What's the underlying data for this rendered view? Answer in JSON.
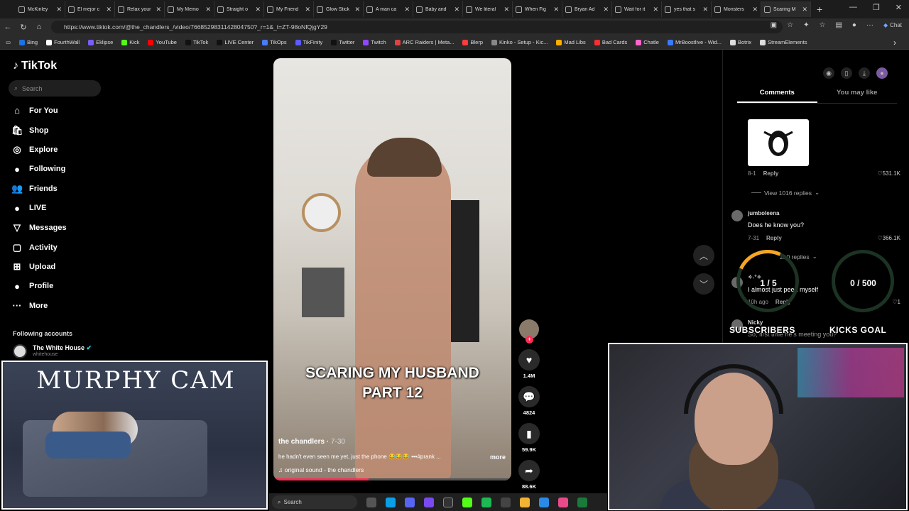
{
  "browser": {
    "tabs": [
      {
        "title": "McKinley"
      },
      {
        "title": "El mejor c"
      },
      {
        "title": "Relax your"
      },
      {
        "title": "My Memo"
      },
      {
        "title": "Straight o"
      },
      {
        "title": "My Friend"
      },
      {
        "title": "Glow Stick"
      },
      {
        "title": "A man ca"
      },
      {
        "title": "Baby and"
      },
      {
        "title": "We literal"
      },
      {
        "title": "When Fig"
      },
      {
        "title": "Bryan Ad"
      },
      {
        "title": "Wait for it"
      },
      {
        "title": "yes that s"
      },
      {
        "title": "Monsters"
      },
      {
        "title": "Scaring M",
        "active": true
      }
    ],
    "url": "https://www.tiktok.com/@the_chandlers_/video/7668529831142804750?_r=1&_t=ZT-98oNfQjgY29",
    "chat_label": "Chat",
    "bookmarks": [
      {
        "label": "Bing",
        "color": "#1a73e8"
      },
      {
        "label": "FourthWall",
        "color": "#ffffff"
      },
      {
        "label": "Eklipse",
        "color": "#7b5cff"
      },
      {
        "label": "Kick",
        "color": "#53fc18"
      },
      {
        "label": "YouTube",
        "color": "#ff0000"
      },
      {
        "label": "TikTok",
        "color": "#111111"
      },
      {
        "label": "LIVE Center",
        "color": "#111111"
      },
      {
        "label": "TikOps",
        "color": "#4a7bff"
      },
      {
        "label": "TikFinity",
        "color": "#5b5bff"
      },
      {
        "label": "Twitter",
        "color": "#111111"
      },
      {
        "label": "Twitch",
        "color": "#9146ff"
      },
      {
        "label": "ARC Raiders | Meta...",
        "color": "#d44"
      },
      {
        "label": "Blerp",
        "color": "#ff3b3b"
      },
      {
        "label": "Kinko - Setup - Kic...",
        "color": "#888888"
      },
      {
        "label": "Mad Libs",
        "color": "#ffae00"
      },
      {
        "label": "Bad Cards",
        "color": "#ff2d2d"
      },
      {
        "label": "Chatle",
        "color": "#ff66cc"
      },
      {
        "label": "MrBoostlive - Wid...",
        "color": "#3a7aff"
      },
      {
        "label": "Botrix",
        "color": "#dddddd"
      },
      {
        "label": "StreamElements",
        "color": "#dddddd"
      }
    ]
  },
  "sidebar": {
    "logo": "TikTok",
    "search_placeholder": "Search",
    "nav": [
      {
        "label": "For You",
        "icon": "home-icon",
        "glyph": "⌂"
      },
      {
        "label": "Shop",
        "icon": "shop-icon",
        "glyph": "🛍"
      },
      {
        "label": "Explore",
        "icon": "compass-icon",
        "glyph": "◎"
      },
      {
        "label": "Following",
        "icon": "following-avatar-icon",
        "glyph": "●"
      },
      {
        "label": "Friends",
        "icon": "friends-icon",
        "glyph": "👥"
      },
      {
        "label": "LIVE",
        "icon": "live-icon",
        "glyph": "●"
      },
      {
        "label": "Messages",
        "icon": "messages-icon",
        "glyph": "▽"
      },
      {
        "label": "Activity",
        "icon": "activity-icon",
        "glyph": "▢"
      },
      {
        "label": "Upload",
        "icon": "upload-icon",
        "glyph": "⊞"
      },
      {
        "label": "Profile",
        "icon": "profile-icon",
        "glyph": "●"
      },
      {
        "label": "More",
        "icon": "more-icon",
        "glyph": "···"
      }
    ],
    "following_title": "Following accounts",
    "following": [
      {
        "name": "The White House",
        "handle": "whitehouse"
      }
    ]
  },
  "video": {
    "caption_line1": "SCARING MY HUSBAND",
    "caption_line2": "PART 12",
    "author": "the chandlers",
    "date": "7-30",
    "description": "he hadn't even seen me yet, just the phone 😂😂😂 •••#prank ...",
    "more_label": "more",
    "sound": "original sound - the chandlers",
    "progress": 0.4
  },
  "actions": {
    "likes": "1.4M",
    "comments": "4824",
    "saves": "59.9K",
    "shares": "88.6K"
  },
  "comments_panel": {
    "tabs": [
      "Comments",
      "You may like"
    ],
    "comments": [
      {
        "date": "8-1",
        "reply": "Reply",
        "likes": "531.1K",
        "view_replies": "View 1016 replies"
      },
      {
        "user": "jumboleena",
        "text": "Does he know you?",
        "date": "7-31",
        "reply": "Reply",
        "likes": "366.1K",
        "view_replies": "210 replies"
      },
      {
        "user": "✧˖°✧",
        "text": "I almost just peed myself",
        "date": "10h ago",
        "reply": "Reply",
        "likes": "1"
      },
      {
        "user": "Nicky",
        "text": "So, first time he's meeting you?"
      }
    ]
  },
  "stream_overlay": {
    "subs_value": "1 / 5",
    "subs_label": "SUBSCRIBERS",
    "subs_progress": 0.2,
    "kicks_value": "0 / 500",
    "kicks_label": "KICKS GOAL",
    "murphy_title": "MURPHY CAM"
  },
  "taskbar": {
    "search": "Search"
  }
}
